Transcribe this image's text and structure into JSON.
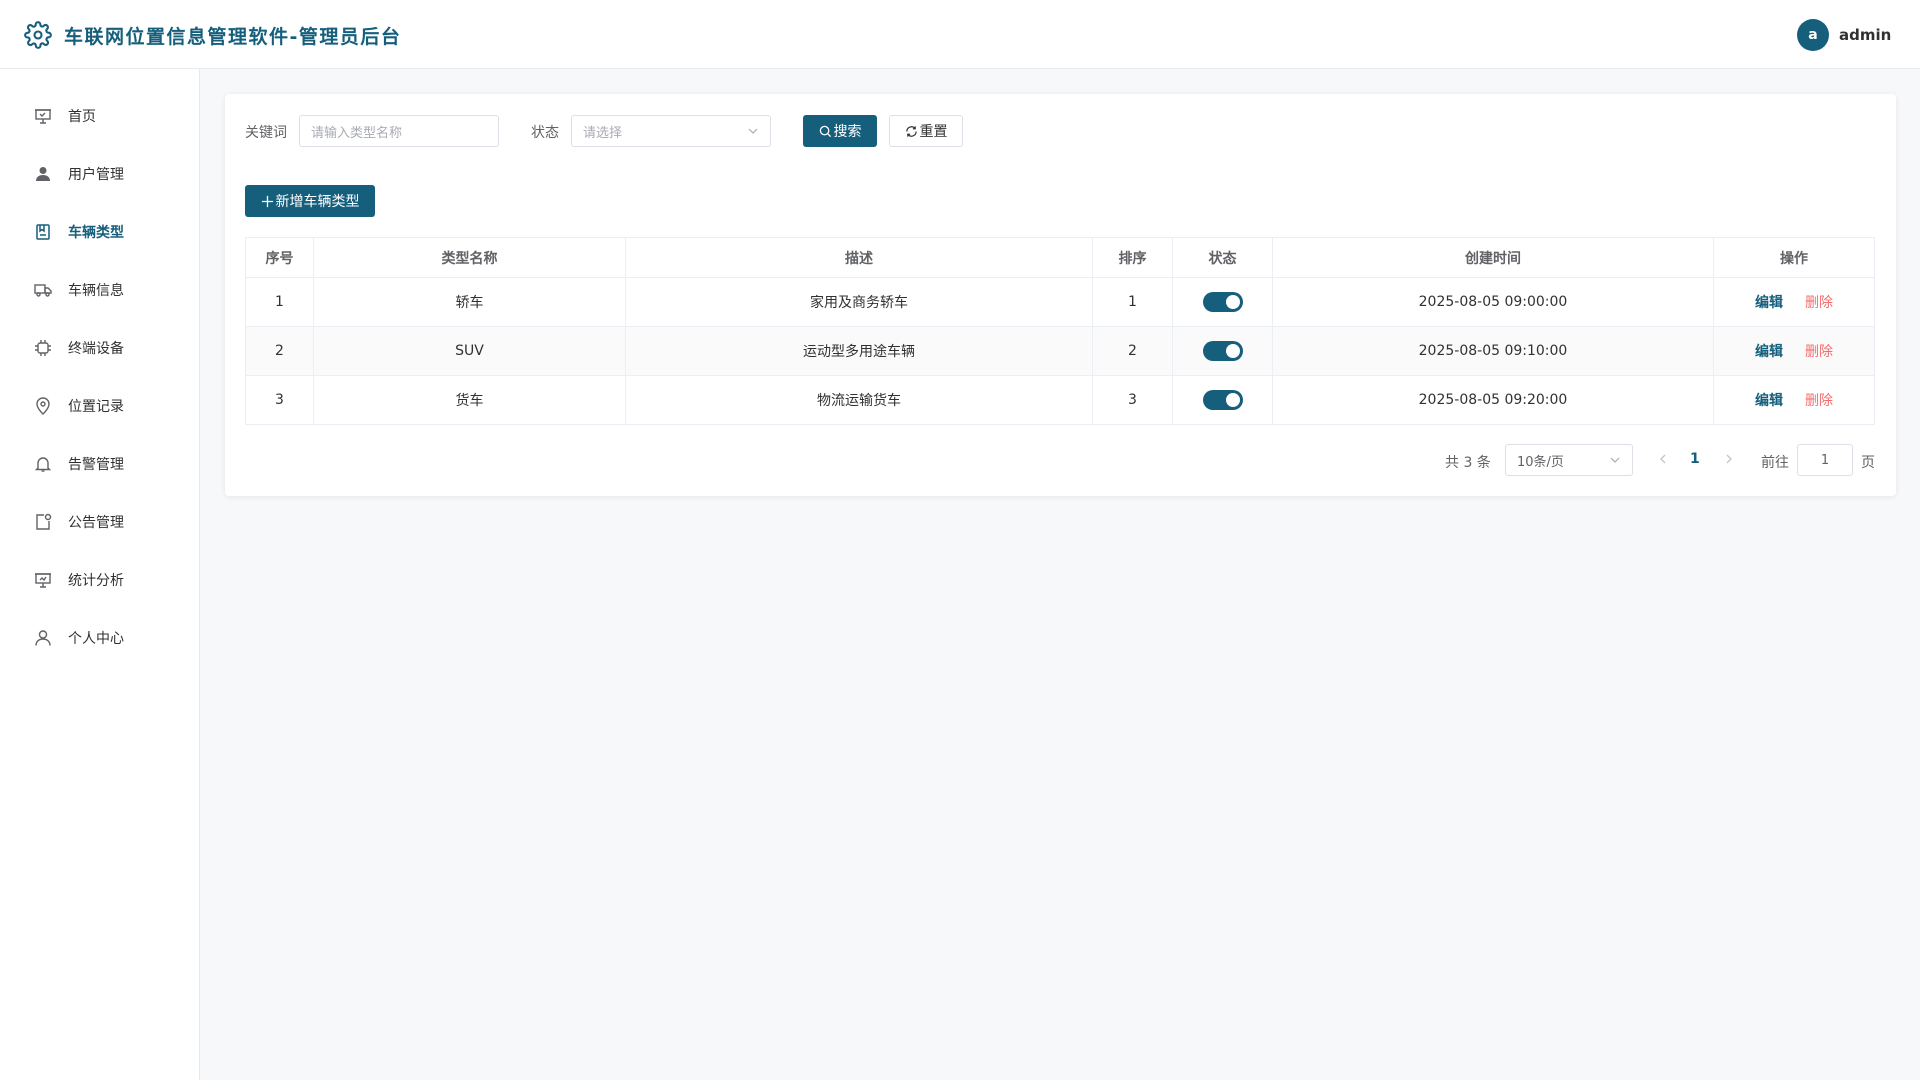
{
  "header": {
    "title": "车联网位置信息管理软件-管理员后台",
    "avatar_letter": "a",
    "username": "admin"
  },
  "colors": {
    "primary": "#155f7d",
    "danger": "#f56c6c"
  },
  "sidebar": {
    "active_index": 2,
    "items": [
      {
        "label": "首页",
        "icon": "home-icon"
      },
      {
        "label": "用户管理",
        "icon": "user-icon"
      },
      {
        "label": "车辆类型",
        "icon": "notebook-icon"
      },
      {
        "label": "车辆信息",
        "icon": "truck-icon"
      },
      {
        "label": "终端设备",
        "icon": "chip-icon"
      },
      {
        "label": "位置记录",
        "icon": "location-icon"
      },
      {
        "label": "告警管理",
        "icon": "bell-icon"
      },
      {
        "label": "公告管理",
        "icon": "notice-icon"
      },
      {
        "label": "统计分析",
        "icon": "chart-icon"
      },
      {
        "label": "个人中心",
        "icon": "user-outline-icon"
      }
    ]
  },
  "search": {
    "keyword_label": "关键词",
    "keyword_placeholder": "请输入类型名称",
    "status_label": "状态",
    "status_placeholder": "请选择",
    "search_button": "搜索",
    "reset_button": "重置"
  },
  "toolbar": {
    "add_button": "新增车辆类型"
  },
  "table": {
    "columns": [
      "序号",
      "类型名称",
      "描述",
      "排序",
      "状态",
      "创建时间",
      "操作"
    ],
    "rows": [
      {
        "index": "1",
        "name": "轿车",
        "desc": "家用及商务轿车",
        "sort": "1",
        "enabled": true,
        "created": "2025-08-05 09:00:00"
      },
      {
        "index": "2",
        "name": "SUV",
        "desc": "运动型多用途车辆",
        "sort": "2",
        "enabled": true,
        "created": "2025-08-05 09:10:00"
      },
      {
        "index": "3",
        "name": "货车",
        "desc": "物流运输货车",
        "sort": "3",
        "enabled": true,
        "created": "2025-08-05 09:20:00"
      }
    ],
    "edit_label": "编辑",
    "delete_label": "删除"
  },
  "pagination": {
    "total_text": "共 3 条",
    "page_size": "10条/页",
    "current_page": "1",
    "goto_label": "前往",
    "goto_value": "1",
    "page_unit": "页"
  }
}
